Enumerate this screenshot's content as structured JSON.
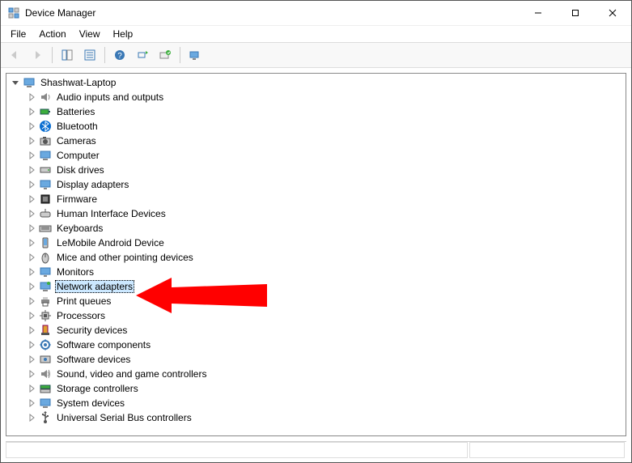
{
  "window": {
    "title": "Device Manager"
  },
  "menus": {
    "file": "File",
    "action": "Action",
    "view": "View",
    "help": "Help"
  },
  "root": {
    "label": "Shashwat-Laptop",
    "items": [
      {
        "label": "Audio inputs and outputs",
        "icon": "speaker-icon"
      },
      {
        "label": "Batteries",
        "icon": "battery-icon"
      },
      {
        "label": "Bluetooth",
        "icon": "bluetooth-icon"
      },
      {
        "label": "Cameras",
        "icon": "camera-icon"
      },
      {
        "label": "Computer",
        "icon": "computer-icon"
      },
      {
        "label": "Disk drives",
        "icon": "disk-icon"
      },
      {
        "label": "Display adapters",
        "icon": "display-icon"
      },
      {
        "label": "Firmware",
        "icon": "firmware-icon"
      },
      {
        "label": "Human Interface Devices",
        "icon": "hid-icon"
      },
      {
        "label": "Keyboards",
        "icon": "keyboard-icon"
      },
      {
        "label": "LeMobile Android Device",
        "icon": "phone-icon"
      },
      {
        "label": "Mice and other pointing devices",
        "icon": "mouse-icon"
      },
      {
        "label": "Monitors",
        "icon": "monitor-icon"
      },
      {
        "label": "Network adapters",
        "icon": "network-icon",
        "selected": true
      },
      {
        "label": "Print queues",
        "icon": "printer-icon"
      },
      {
        "label": "Processors",
        "icon": "cpu-icon"
      },
      {
        "label": "Security devices",
        "icon": "security-icon"
      },
      {
        "label": "Software components",
        "icon": "component-icon"
      },
      {
        "label": "Software devices",
        "icon": "softdev-icon"
      },
      {
        "label": "Sound, video and game controllers",
        "icon": "sound-icon"
      },
      {
        "label": "Storage controllers",
        "icon": "storage-icon"
      },
      {
        "label": "System devices",
        "icon": "system-icon"
      },
      {
        "label": "Universal Serial Bus controllers",
        "icon": "usb-icon"
      }
    ]
  }
}
